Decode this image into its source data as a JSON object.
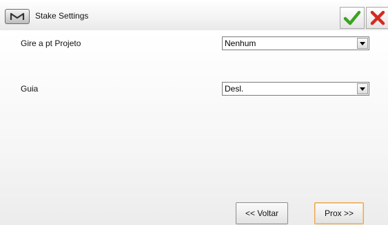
{
  "titlebar": {
    "title": "Stake Settings",
    "menu_icon": "m-logo-icon",
    "accept_icon": "checkmark-icon",
    "cancel_icon": "close-icon",
    "accept_color": "#3aa31e",
    "cancel_color": "#d42a1f"
  },
  "form": {
    "rotate_label": "Gire a pt Projeto",
    "rotate_value": "Nenhum",
    "guide_label": "Guia",
    "guide_value": "Desl."
  },
  "footer": {
    "back_label": "<< Voltar",
    "next_label": "Prox >>"
  }
}
